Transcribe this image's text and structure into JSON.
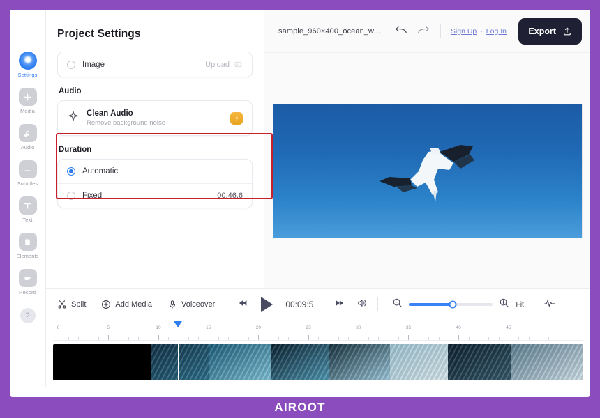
{
  "brand": {
    "text": "AIROOT",
    "bg": "#8b4cbe"
  },
  "sidebar": {
    "items": [
      {
        "label": "Settings",
        "icon": "settings-circle-icon",
        "active": true
      },
      {
        "label": "Media",
        "icon": "plus-icon",
        "active": false
      },
      {
        "label": "Audio",
        "icon": "music-note-icon",
        "active": false
      },
      {
        "label": "Subtitles",
        "icon": "subtitles-icon",
        "active": false
      },
      {
        "label": "Text",
        "icon": "text-t-icon",
        "active": false
      },
      {
        "label": "Elements",
        "icon": "shapes-icon",
        "active": false
      },
      {
        "label": "Record",
        "icon": "video-camera-icon",
        "active": false
      }
    ],
    "help_label": "?"
  },
  "panel": {
    "title": "Project Settings",
    "image_row": {
      "label": "Image",
      "selected": false,
      "action_label": "Upload",
      "action_icon": "upload-image-icon"
    },
    "audio_section": {
      "title": "Audio",
      "item": {
        "title": "Clean Audio",
        "subtitle": "Remove background noise",
        "icon": "sparkle-icon",
        "badge_icon": "lightning-badge-icon",
        "badge_color": "#e9a321"
      },
      "highlight_color": "#c8202a"
    },
    "duration_section": {
      "title": "Duration",
      "options": [
        {
          "label": "Automatic",
          "selected": true,
          "value": ""
        },
        {
          "label": "Fixed",
          "selected": false,
          "value": "00:46.6"
        }
      ]
    }
  },
  "topbar": {
    "project_name": "sample_960×400_ocean_w...",
    "undo_icon": "undo-arrow-icon",
    "redo_icon": "redo-arrow-icon",
    "sign_up_label": "Sign Up",
    "separator": "·",
    "log_in_label": "Log In",
    "export_label": "Export",
    "export_icon": "upload-icon",
    "export_bg": "#1f2033"
  },
  "preview": {
    "description": "seabird gliding against blue sky"
  },
  "toolbar": {
    "split_label": "Split",
    "split_icon": "scissors-icon",
    "add_media_label": "Add Media",
    "add_media_icon": "plus-circle-icon",
    "voiceover_label": "Voiceover",
    "voiceover_icon": "microphone-icon",
    "rewind_icon": "rewind-icon",
    "play_icon": "play-icon",
    "timecode": "00:09:5",
    "forward_icon": "fast-forward-icon",
    "volume_icon": "speaker-icon",
    "zoom_out_icon": "zoom-out-icon",
    "zoom_in_icon": "zoom-in-icon",
    "zoom_percent": 52,
    "fit_label": "Fit",
    "waveform_icon": "waveform-icon"
  },
  "timeline": {
    "tick_labels": [
      "0",
      "5",
      "10",
      "15",
      "20",
      "25",
      "30",
      "35",
      "40",
      "45"
    ],
    "playhead_position_pct": 23.5,
    "clips": [
      {
        "width_pct": 18.5,
        "colors": [
          "#000000",
          "#000000"
        ]
      },
      {
        "width_pct": 11.0,
        "colors": [
          "#123246",
          "#2c6f8c"
        ]
      },
      {
        "width_pct": 11.5,
        "colors": [
          "#1d5f7c",
          "#7fc0d6"
        ]
      },
      {
        "width_pct": 11.0,
        "colors": [
          "#0a2230",
          "#4e97b4"
        ]
      },
      {
        "width_pct": 11.5,
        "colors": [
          "#16313f",
          "#9dc9dc"
        ]
      },
      {
        "width_pct": 11.0,
        "colors": [
          "#9fc4d2",
          "#d6e6ec"
        ]
      },
      {
        "width_pct": 12.0,
        "colors": [
          "#0d2230",
          "#35596b"
        ]
      },
      {
        "width_pct": 13.5,
        "colors": [
          "#5d7f92",
          "#cfe0e8"
        ]
      }
    ]
  }
}
